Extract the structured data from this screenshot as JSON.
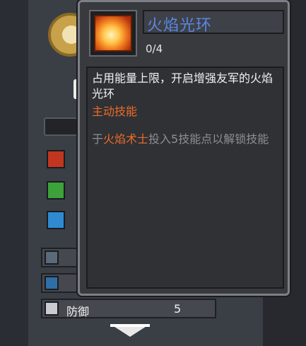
{
  "skill": {
    "name": "火焰光环",
    "level": "0/4",
    "description": "占用能量上限，开启增强友军的火焰光环",
    "type": "主动技能",
    "unlock_prefix": "于",
    "unlock_class": "火焰术士",
    "unlock_suffix": "投入5技能点以解锁技能"
  },
  "stats": {
    "defense_label": "防御",
    "defense_value": "5"
  },
  "colors": {
    "accent": "#ec6b28",
    "title": "#5b87e6"
  }
}
